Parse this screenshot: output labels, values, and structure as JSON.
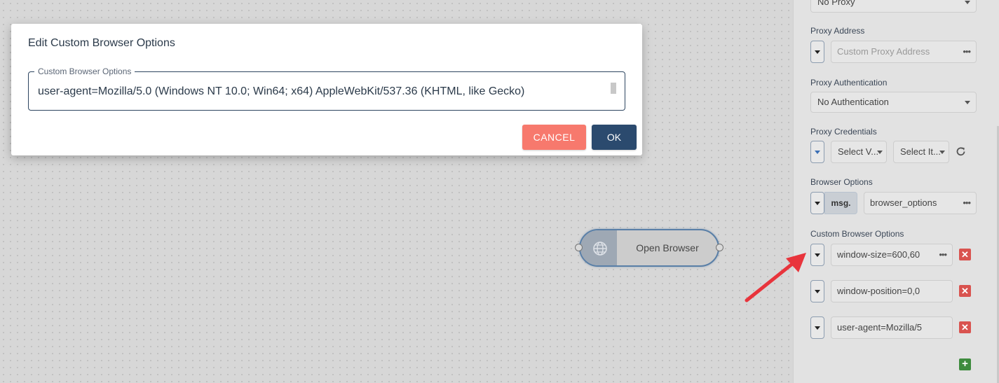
{
  "dialog": {
    "title": "Edit Custom Browser Options",
    "field_legend": "Custom Browser Options",
    "field_value": "user-agent=Mozilla/5.0 (Windows NT 10.0; Win64; x64) AppleWebKit/537.36 (KHTML, like Gecko)",
    "cancel_label": "CANCEL",
    "ok_label": "OK"
  },
  "node": {
    "label": "Open Browser",
    "icon": "globe-icon"
  },
  "panel": {
    "proxy_type_value": "No Proxy",
    "proxy_address_label": "Proxy Address",
    "proxy_address_placeholder": "Custom Proxy Address",
    "proxy_auth_label": "Proxy Authentication",
    "proxy_auth_value": "No Authentication",
    "proxy_credentials_label": "Proxy Credentials",
    "credentials_select_1": "Select V...",
    "credentials_select_2": "Select It...",
    "browser_options_label": "Browser Options",
    "browser_options_prefix": "msg.",
    "browser_options_value": "browser_options",
    "custom_options_label": "Custom Browser Options",
    "custom_options": [
      {
        "value": "window-size=600,60"
      },
      {
        "value": "window-position=0,0"
      },
      {
        "value": "user-agent=Mozilla/5"
      }
    ],
    "more_glyph": "•••",
    "delete_glyph": "✕",
    "add_glyph": "+"
  },
  "colors": {
    "cancel": "#f7796d",
    "ok": "#2b4a6e",
    "delete": "#d9534f",
    "add": "#3d8b3d",
    "annotation_arrow": "#e8343c"
  }
}
